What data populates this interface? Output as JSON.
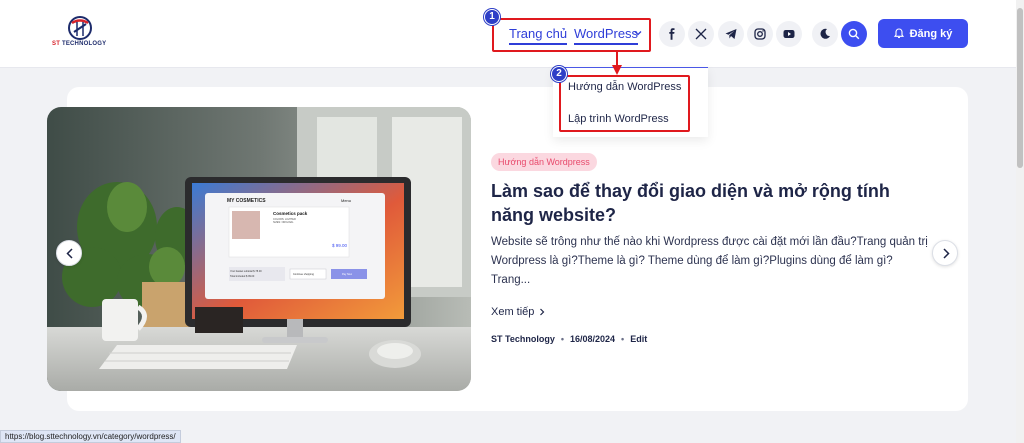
{
  "header": {
    "logo_text_accent": "ST",
    "logo_text_rest": "TECHNOLOGY",
    "nav": {
      "home": "Trang chủ",
      "wordpress": "WordPress"
    },
    "signup_label": "Đăng ký",
    "social_icons": [
      "facebook-icon",
      "x-icon",
      "telegram-icon",
      "instagram-icon",
      "youtube-icon",
      "moon-icon",
      "search-icon"
    ]
  },
  "annotations": {
    "badge1": "1",
    "badge2": "2"
  },
  "dropdown": {
    "items": [
      "Hướng dẫn WordPress",
      "Lập trình WordPress"
    ]
  },
  "post": {
    "category": "Hướng dẫn Wordpress",
    "title": "Làm sao để thay đổi giao diện và mở rộng tính năng website?",
    "excerpt": "Website sẽ trông như thế nào khi Wordpress được cài đặt mới lần đầu?Trang quản trị Wordpress là gì?Theme là gì? Theme dùng để làm gì?Plugins dùng để làm gì?Trang...",
    "read_more": "Xem tiếp",
    "author": "ST Technology",
    "date": "16/08/2024",
    "edit": "Edit"
  },
  "hero_screen": {
    "brand": "MY COSMETICS",
    "menu": "Menu",
    "product": "Cosmetics pack",
    "product_sub1": "COLORS: LIGHTER",
    "product_sub2": "SIZES: ORIGINAL",
    "price": "$ 99.00",
    "subtotal": "Your basket subtotal $ 78.00",
    "total": "Total included $ 99.00",
    "continue": "Continue shopping",
    "pay": "Pay Now"
  },
  "status_bar": {
    "url": "https://blog.sttechnology.vn/category/wordpress/"
  },
  "colors": {
    "accent": "#3d4ef0",
    "highlight": "#e0191e",
    "tag_bg": "#fbd8e0",
    "tag_text": "#e84a6c"
  }
}
